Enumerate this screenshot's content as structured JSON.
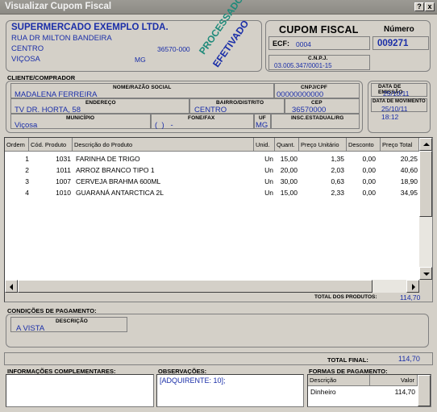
{
  "window": {
    "title": "Visualizar Cupom Fiscal",
    "help_label": "?",
    "close_label": "x"
  },
  "company": {
    "name": "SUPERMERCADO EXEMPLO LTDA.",
    "street": "RUA DR MILTON BANDEIRA",
    "district": "CENTRO",
    "cep": "36570-000",
    "city": "VIÇOSA",
    "state": "MG"
  },
  "stamp": {
    "line1": "PROCESSADO",
    "line2": "EFETIVADO"
  },
  "cupom": {
    "title": "CUPOM FISCAL",
    "number_label": "Número",
    "number": "009271",
    "ecf_label": "ECF:",
    "ecf": "0004",
    "cnpj_label": "C.N.P.J.",
    "cnpj": "03.005.347/0001-15"
  },
  "client": {
    "section_label": "CLIENTE/COMPRADOR",
    "name_label": "NOME/RAZÃO SOCIAL",
    "name": "MADALENA FERREIRA",
    "cnpj_label": "CNPJ/CPF",
    "cnpj": "00000000000",
    "address_label": "ENDEREÇO",
    "address": "TV DR. HORTA, 58",
    "district_label": "BAIRRO/DISTRITO",
    "district": "CENTRO",
    "cep_label": "CEP",
    "cep": "36570000",
    "city_label": "MUNICÍPIO",
    "city": "Viçosa",
    "phone_label": "FONE/FAX",
    "phone": "(  )   -",
    "uf_label": "UF",
    "uf": "MG",
    "ie_label": "INSC.ESTADUAL/RG",
    "ie": ""
  },
  "dates": {
    "emission_label": "DATA DE EMISSÃO",
    "emission": "25/10/11",
    "movement_label": "DATA DE MOVIMENTO",
    "movement": "25/10/11 18:12"
  },
  "items_table": {
    "columns": [
      "Ordem",
      "Cód. Produto",
      "Descrição do Produto",
      "Unid.",
      "Quant.",
      "Preço Unitário",
      "Desconto",
      "Preço Total"
    ],
    "rows": [
      [
        "1",
        "1031",
        "FARINHA DE TRIGO",
        "Un",
        "15,00",
        "1,35",
        "0,00",
        "20,25"
      ],
      [
        "2",
        "1011",
        "ARROZ BRANCO TIPO 1",
        "Un",
        "20,00",
        "2,03",
        "0,00",
        "40,60"
      ],
      [
        "3",
        "1007",
        "CERVEJA BRAHMA 600ML",
        "Un",
        "30,00",
        "0,63",
        "0,00",
        "18,90"
      ],
      [
        "4",
        "1010",
        "GUARANÁ ANTARCTICA 2L",
        "Un",
        "15,00",
        "2,33",
        "0,00",
        "34,95"
      ]
    ],
    "total_label": "TOTAL DOS PRODUTOS:",
    "total": "114,70"
  },
  "payment": {
    "section_label": "CONDIÇÕES DE PAGAMENTO:",
    "description_label": "DESCRIÇÃO",
    "description": "A VISTA"
  },
  "total_final": {
    "label": "TOTAL FINAL:",
    "value": "114,70"
  },
  "info": {
    "label": "INFORMAÇÕES COMPLEMENTARES:",
    "value": ""
  },
  "notes": {
    "label": "OBSERVAÇÕES:",
    "value": "[ADQUIRENTE: 10];"
  },
  "payment_forms": {
    "label": "FORMAS DE PAGAMENTO:",
    "col_description": "Descrição",
    "col_value": "Valor",
    "rows": [
      [
        "Dinheiro",
        "114,70"
      ]
    ]
  },
  "colors": {
    "blue_text": "#1a2ea8",
    "stamp_green": "#1f8a7a",
    "stamp_blue": "#1a2ea8",
    "window_bg": "#d4d0c8"
  }
}
